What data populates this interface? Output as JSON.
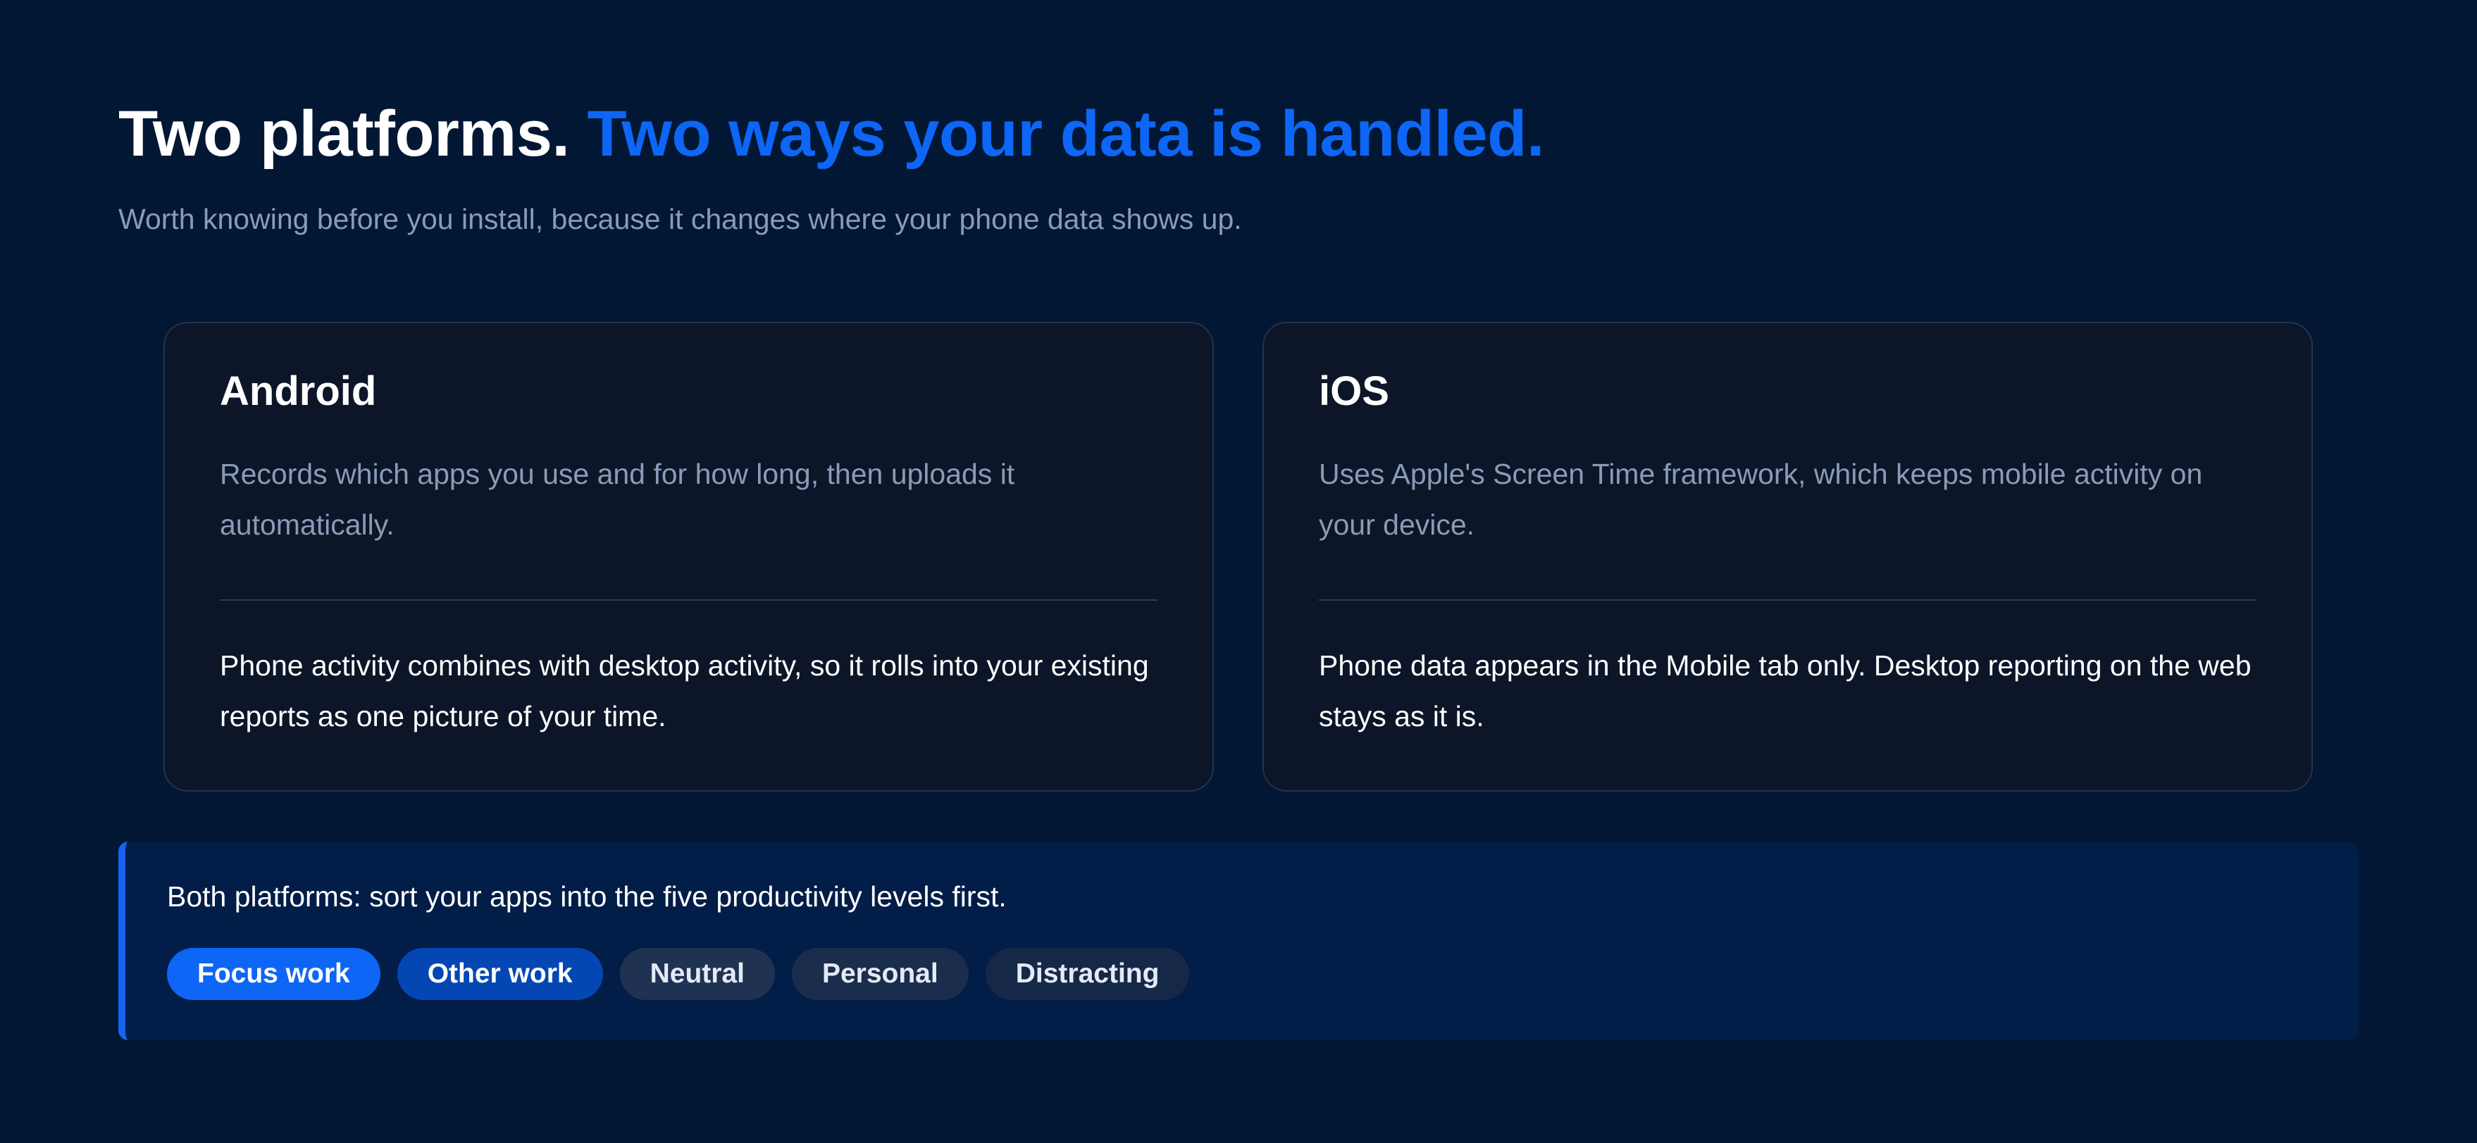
{
  "header": {
    "title_lead": "Two platforms.",
    "title_accent": "Two ways your data is handled.",
    "subtitle": "Worth knowing before you install, because it changes where your phone data shows up."
  },
  "platforms": [
    {
      "title": "Android",
      "description": "Records which apps you use and for how long, then uploads it automatically.",
      "note": "Phone activity combines with desktop activity, so it rolls into your existing reports as one picture of your time."
    },
    {
      "title": "iOS",
      "description": "Uses Apple's Screen Time framework, which keeps mobile activity on your device.",
      "note": "Phone data appears in the Mobile tab only. Desktop reporting on the web stays as it is."
    }
  ],
  "callout": {
    "text": "Both platforms: sort your apps into the five productivity levels first.",
    "levels": [
      {
        "label": "Focus work",
        "color": "#0d66f5"
      },
      {
        "label": "Other work",
        "color": "#0447b4"
      },
      {
        "label": "Neutral",
        "color": "#1f3252"
      },
      {
        "label": "Personal",
        "color": "#1b2d4c"
      },
      {
        "label": "Distracting",
        "color": "#162848"
      }
    ]
  },
  "colors": {
    "background": "#021733",
    "accent": "#0d66f5",
    "card": "#0c1628",
    "callout": "#021d47"
  }
}
